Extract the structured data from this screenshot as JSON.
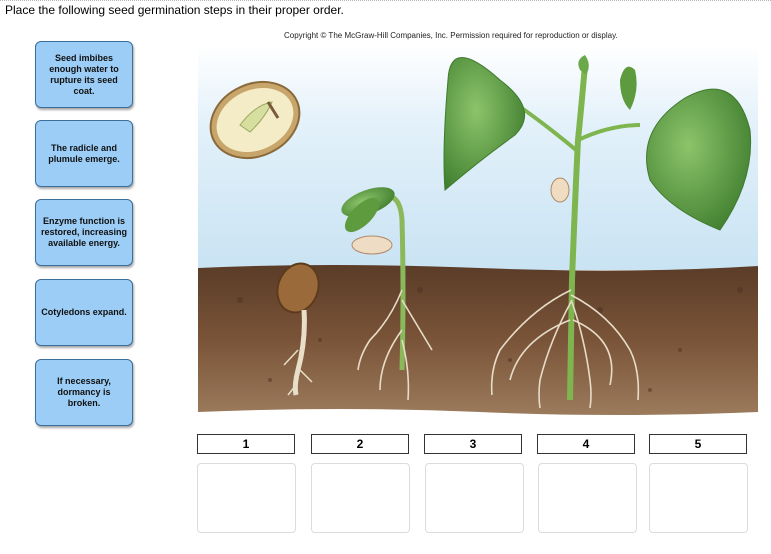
{
  "instruction": "Place the following seed germination steps in their proper order.",
  "copyright": "Copyright © The McGraw-Hill Companies, Inc. Permission required for reproduction or display.",
  "cards": [
    {
      "label": "Seed imbibes enough water to rupture its seed coat."
    },
    {
      "label": "The radicle and plumule emerge."
    },
    {
      "label": "Enzyme function is restored, increasing available energy."
    },
    {
      "label": "Cotyledons expand."
    },
    {
      "label": "If necessary, dormancy is broken."
    }
  ],
  "slots": [
    {
      "number": "1"
    },
    {
      "number": "2"
    },
    {
      "number": "3"
    },
    {
      "number": "4"
    },
    {
      "number": "5"
    }
  ],
  "colors": {
    "card_fill": "#9bcdf6",
    "card_border": "#3a6f9b",
    "sky": "#d9ecf7",
    "soil": "#6b4a34",
    "leaf": "#6aa84a"
  }
}
